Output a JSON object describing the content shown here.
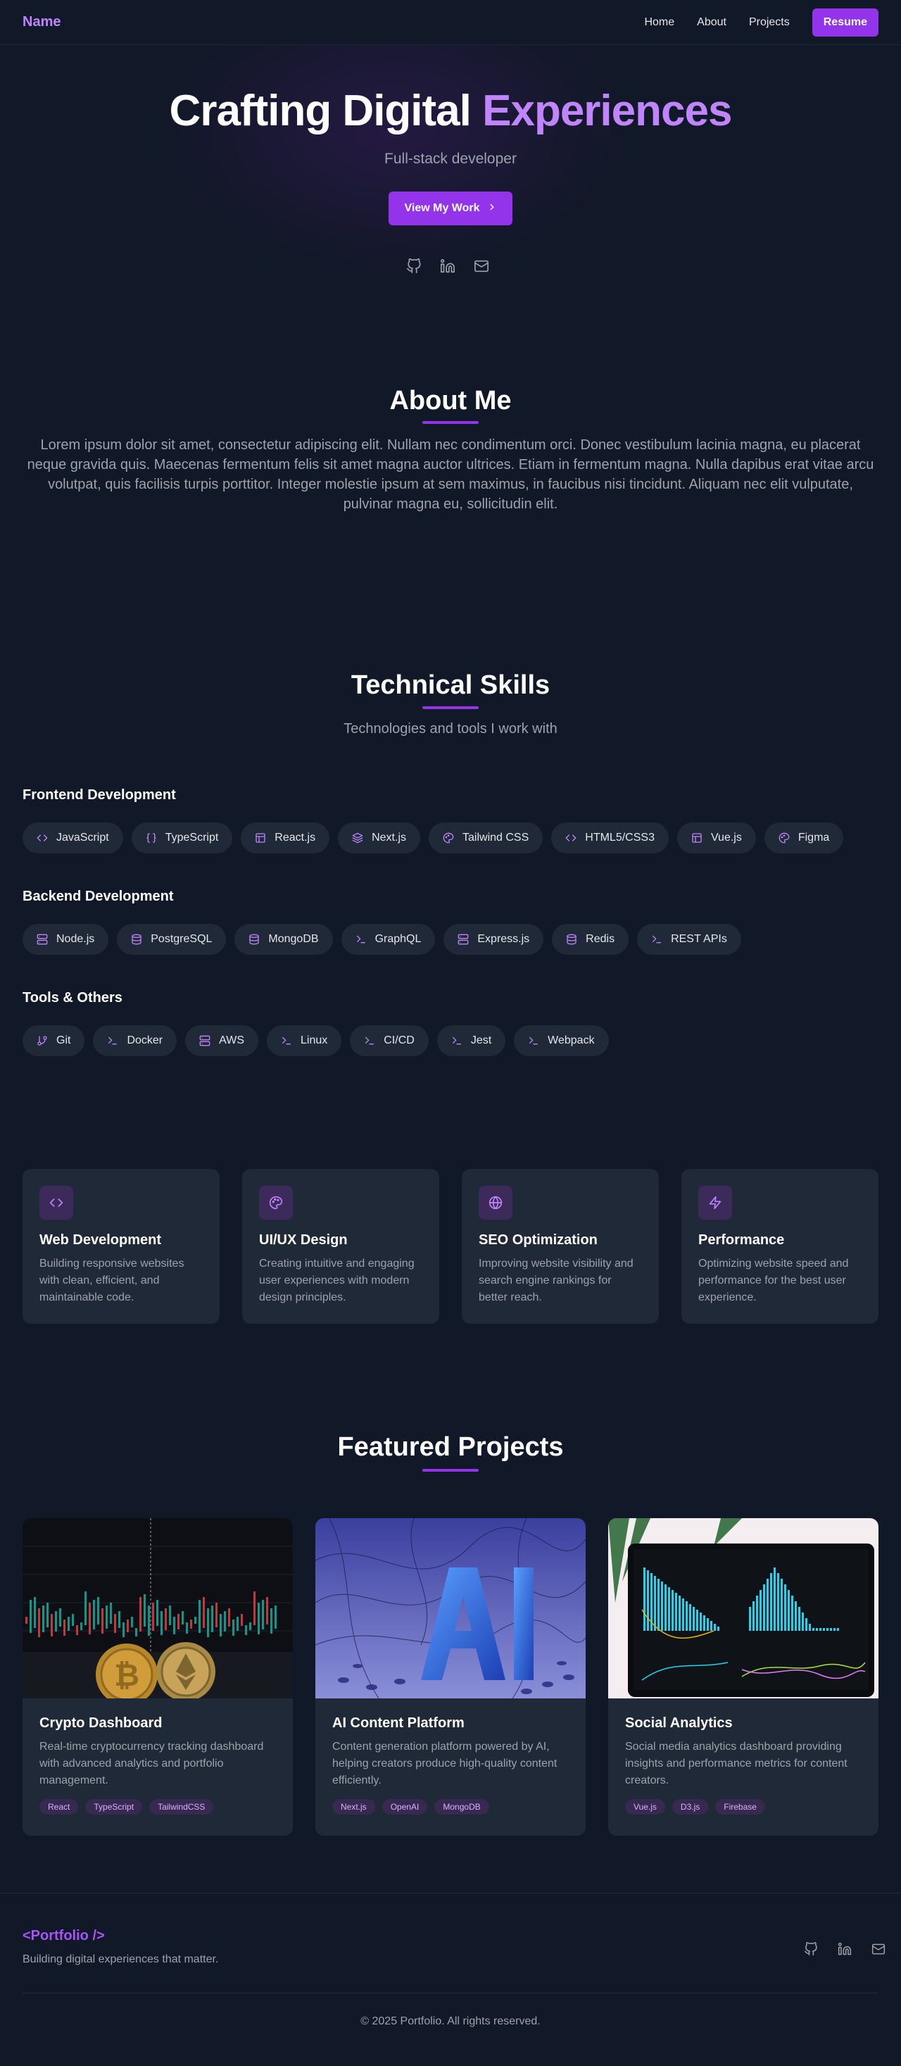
{
  "nav": {
    "brand": "Name",
    "links": [
      "Home",
      "About",
      "Projects"
    ],
    "resume": "Resume"
  },
  "hero": {
    "title_main": "Crafting Digital ",
    "title_accent": "Experiences",
    "subtitle": "Full-stack developer",
    "cta": "View My Work",
    "social_icons": [
      "github-icon",
      "linkedin-icon",
      "mail-icon"
    ]
  },
  "about": {
    "title": "About Me",
    "text": "Lorem ipsum dolor sit amet, consectetur adipiscing elit. Nullam nec condimentum orci. Donec vestibulum lacinia magna, eu placerat neque gravida quis. Maecenas fermentum felis sit amet magna auctor ultrices. Etiam in fermentum magna. Nulla dapibus erat vitae arcu volutpat, quis facilisis turpis porttitor. Integer molestie ipsum at sem maximus, in faucibus nisi tincidunt. Aliquam nec elit vulputate, pulvinar magna eu, sollicitudin elit."
  },
  "skills": {
    "title": "Technical Skills",
    "subtitle": "Technologies and tools I work with",
    "groups": [
      {
        "title": "Frontend Development",
        "items": [
          {
            "label": "JavaScript",
            "icon": "code-icon"
          },
          {
            "label": "TypeScript",
            "icon": "braces-icon"
          },
          {
            "label": "React.js",
            "icon": "layout-icon"
          },
          {
            "label": "Next.js",
            "icon": "layers-icon"
          },
          {
            "label": "Tailwind CSS",
            "icon": "palette-icon"
          },
          {
            "label": "HTML5/CSS3",
            "icon": "code-icon"
          },
          {
            "label": "Vue.js",
            "icon": "layout-icon"
          },
          {
            "label": "Figma",
            "icon": "palette-icon"
          }
        ]
      },
      {
        "title": "Backend Development",
        "items": [
          {
            "label": "Node.js",
            "icon": "server-icon"
          },
          {
            "label": "PostgreSQL",
            "icon": "database-icon"
          },
          {
            "label": "MongoDB",
            "icon": "database-icon"
          },
          {
            "label": "GraphQL",
            "icon": "terminal-icon"
          },
          {
            "label": "Express.js",
            "icon": "server-icon"
          },
          {
            "label": "Redis",
            "icon": "database-icon"
          },
          {
            "label": "REST APIs",
            "icon": "terminal-icon"
          }
        ]
      },
      {
        "title": "Tools & Others",
        "items": [
          {
            "label": "Git",
            "icon": "git-branch-icon"
          },
          {
            "label": "Docker",
            "icon": "terminal-icon"
          },
          {
            "label": "AWS",
            "icon": "server-icon"
          },
          {
            "label": "Linux",
            "icon": "terminal-icon"
          },
          {
            "label": "CI/CD",
            "icon": "terminal-icon"
          },
          {
            "label": "Jest",
            "icon": "terminal-icon"
          },
          {
            "label": "Webpack",
            "icon": "terminal-icon"
          }
        ]
      }
    ]
  },
  "services": [
    {
      "title": "Web Development",
      "text": "Building responsive websites with clean, efficient, and maintainable code.",
      "icon": "code-icon"
    },
    {
      "title": "UI/UX Design",
      "text": "Creating intuitive and engaging user experiences with modern design principles.",
      "icon": "palette-icon"
    },
    {
      "title": "SEO Optimization",
      "text": "Improving website visibility and search engine rankings for better reach.",
      "icon": "globe-icon"
    },
    {
      "title": "Performance",
      "text": "Optimizing website speed and performance for the best user experience.",
      "icon": "zap-icon"
    }
  ],
  "projects": {
    "title": "Featured Projects",
    "items": [
      {
        "title": "Crypto Dashboard",
        "text": "Real-time cryptocurrency tracking dashboard with advanced analytics and portfolio management.",
        "tags": [
          "React",
          "TypeScript",
          "TailwindCSS"
        ]
      },
      {
        "title": "AI Content Platform",
        "text": "Content generation platform powered by AI, helping creators produce high-quality content efficiently.",
        "tags": [
          "Next.js",
          "OpenAI",
          "MongoDB"
        ]
      },
      {
        "title": "Social Analytics",
        "text": "Social media analytics dashboard providing insights and performance metrics for content creators.",
        "tags": [
          "Vue.js",
          "D3.js",
          "Firebase"
        ]
      }
    ]
  },
  "footer": {
    "brand": "<Portfolio />",
    "tagline": "Building digital experiences that matter.",
    "copyright": "© 2025 Portfolio. All rights reserved."
  },
  "colors": {
    "accent": "#9333ea",
    "accent_light": "#c084fc",
    "background": "#111827",
    "surface": "#1f2937"
  }
}
